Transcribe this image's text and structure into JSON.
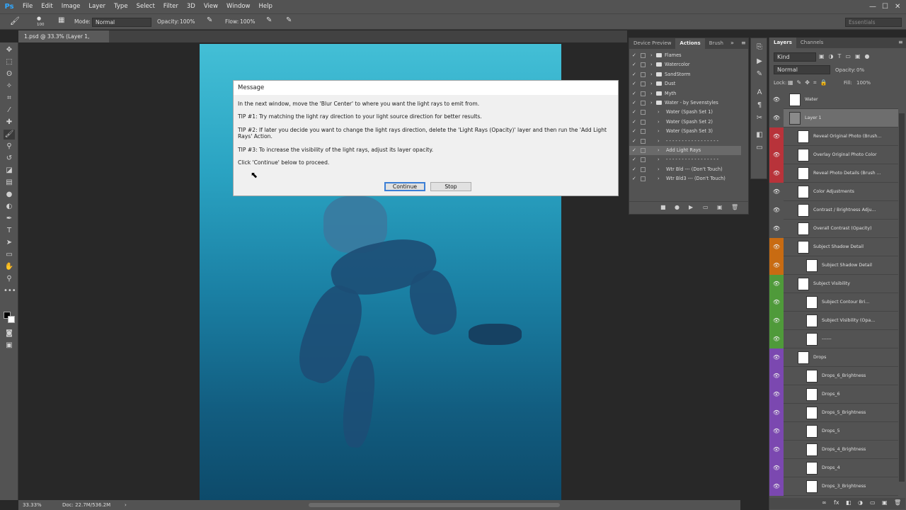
{
  "app": {
    "logo": "Ps"
  },
  "menu": [
    "File",
    "Edit",
    "Image",
    "Layer",
    "Type",
    "Select",
    "Filter",
    "3D",
    "View",
    "Window",
    "Help"
  ],
  "window_controls": {
    "min": "—",
    "max": "☐",
    "close": "✕"
  },
  "workspace_label": "Essentials",
  "options": {
    "brush_size": "100",
    "mode_label": "Mode:",
    "mode_value": "Normal",
    "opacity_label": "Opacity:",
    "opacity_value": "100%",
    "flow_label": "Flow:",
    "flow_value": "100%"
  },
  "document_tab": "1.psd @ 33.3% (Layer 1, RGB/8) *",
  "status": {
    "zoom": "33.33%",
    "doc": "Doc: 22.7M/536.2M"
  },
  "dialog": {
    "title": "Message",
    "line1": "In the next window, move the 'Blur Center' to where you want the light rays to emit from.",
    "tip1": "TIP #1: Try matching the light ray direction to your light source direction for better results.",
    "tip2": "TIP #2: If later you decide you want to change the light rays direction, delete the 'Light Rays (Opacity)' layer and then run the 'Add Light Rays' Action.",
    "tip3": "TIP #3: To increase the visibility of the light rays, adjust its layer opacity.",
    "proceed": "Click 'Continue' below to proceed.",
    "continue_label": "Continue",
    "stop_label": "Stop"
  },
  "actions_panel": {
    "tabs": [
      "Device Preview",
      "Actions",
      "Brush"
    ],
    "items": [
      {
        "name": "Flames",
        "folder": true
      },
      {
        "name": "Watercolor",
        "folder": true
      },
      {
        "name": "SandStorm",
        "folder": true
      },
      {
        "name": "Dust",
        "folder": true
      },
      {
        "name": "Myth",
        "folder": true
      },
      {
        "name": "Water - by Sevenstyles",
        "folder": true
      },
      {
        "name": "Water (Spash Set 1)",
        "folder": false
      },
      {
        "name": "Water (Spash Set 2)",
        "folder": false
      },
      {
        "name": "Water (Spash Set 3)",
        "folder": false
      },
      {
        "name": "- - - - - - - - - - - - - - - - -",
        "folder": false
      },
      {
        "name": "Add Light Rays",
        "folder": false
      },
      {
        "name": "- - - - - - - - - - - - - - - - -",
        "folder": false
      },
      {
        "name": "Wtr Bld --- (Don't Touch)",
        "folder": false
      },
      {
        "name": "Wtr Bld3 --- (Don't Touch)",
        "folder": false
      }
    ]
  },
  "layers_panel": {
    "tabs": [
      "Layers",
      "Channels"
    ],
    "filter": "Kind",
    "blend": "Normal",
    "opacity_label": "Opacity:",
    "opacity_value": "0%",
    "lock_label": "Lock:",
    "fill_label": "Fill:",
    "fill_value": "100%",
    "layers": [
      {
        "name": "Water",
        "color": "#535353",
        "indent": 0
      },
      {
        "name": "Layer 1",
        "color": "#535353",
        "indent": 0
      },
      {
        "name": "Reveal Original Photo (Brush...",
        "color": "#b8333a",
        "indent": 1
      },
      {
        "name": "Overlay Original Photo Color",
        "color": "#b8333a",
        "indent": 1
      },
      {
        "name": "Reveal Photo Details (Brush ...",
        "color": "#b8333a",
        "indent": 1
      },
      {
        "name": "Color Adjustments",
        "color": "#535353",
        "indent": 1
      },
      {
        "name": "Contrast / Brightness Adju...",
        "color": "#535353",
        "indent": 1
      },
      {
        "name": "Overall Contrast (Opacity)",
        "color": "#535353",
        "indent": 1
      },
      {
        "name": "Subject Shadow Detail",
        "color": "#c86b12",
        "indent": 1
      },
      {
        "name": "Subject Shadow Detail",
        "color": "#c86b12",
        "indent": 2
      },
      {
        "name": "Subject Visibility",
        "color": "#4f9a3a",
        "indent": 1
      },
      {
        "name": "Subject Contour Bri...",
        "color": "#4f9a3a",
        "indent": 2
      },
      {
        "name": "Subject Visibility (Opa...",
        "color": "#4f9a3a",
        "indent": 2
      },
      {
        "name": "------",
        "color": "#4f9a3a",
        "indent": 2
      },
      {
        "name": "Drops",
        "color": "#7b48b0",
        "indent": 1
      },
      {
        "name": "Drops_6_Brightness",
        "color": "#7b48b0",
        "indent": 2
      },
      {
        "name": "Drops_6",
        "color": "#7b48b0",
        "indent": 2
      },
      {
        "name": "Drops_5_Brightness",
        "color": "#7b48b0",
        "indent": 2
      },
      {
        "name": "Drops_5",
        "color": "#7b48b0",
        "indent": 2
      },
      {
        "name": "Drops_4_Brightness",
        "color": "#7b48b0",
        "indent": 2
      },
      {
        "name": "Drops_4",
        "color": "#7b48b0",
        "indent": 2
      },
      {
        "name": "Drops_3_Brightness",
        "color": "#7b48b0",
        "indent": 2
      }
    ],
    "footer_icons": [
      "∞",
      "fx",
      "◧",
      "◑",
      "▭",
      "▣",
      "🗑"
    ]
  }
}
